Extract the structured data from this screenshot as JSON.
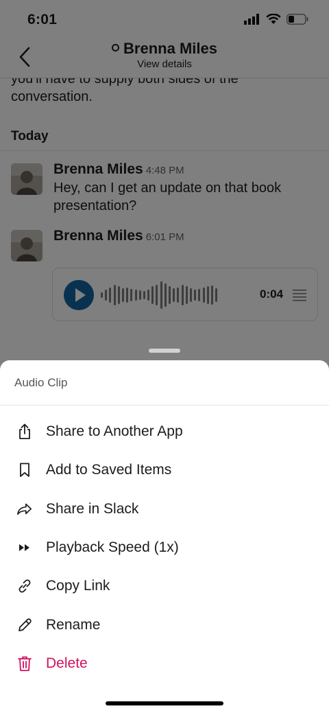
{
  "status_bar": {
    "time": "6:01"
  },
  "header": {
    "title": "Brenna Miles",
    "subtitle": "View details"
  },
  "conversation": {
    "previous_text": "you'll have to supply both sides of the conversation.",
    "day_label": "Today",
    "messages": [
      {
        "sender": "Brenna Miles",
        "time": "4:48 PM",
        "text": "Hey, can I get an update on that book presentation?"
      },
      {
        "sender": "Brenna Miles",
        "time": "6:01 PM",
        "text": ""
      }
    ],
    "audio_clip": {
      "duration": "0:04"
    }
  },
  "sheet": {
    "title": "Audio Clip",
    "items": [
      {
        "label": "Share to Another App",
        "icon": "share-upload-icon"
      },
      {
        "label": "Add to Saved Items",
        "icon": "bookmark-icon"
      },
      {
        "label": "Share in Slack",
        "icon": "forward-arrow-icon"
      },
      {
        "label": "Playback Speed (1x)",
        "icon": "fast-forward-icon"
      },
      {
        "label": "Copy Link",
        "icon": "link-icon"
      },
      {
        "label": "Rename",
        "icon": "pencil-icon"
      },
      {
        "label": "Delete",
        "icon": "trash-icon",
        "color": "#d01160"
      }
    ]
  },
  "colors": {
    "accent": "#1264a3",
    "danger": "#d01160"
  }
}
